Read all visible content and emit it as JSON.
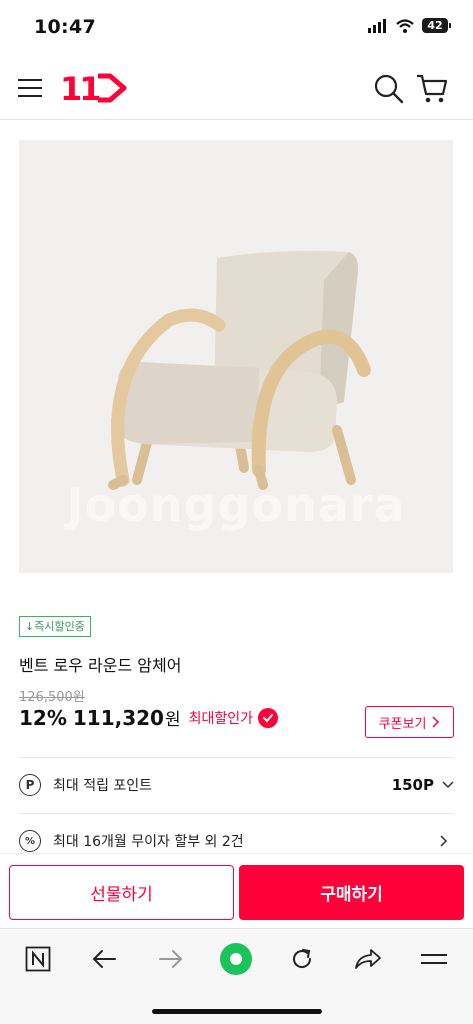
{
  "status_bar": {
    "time": "10:47",
    "battery": "42"
  },
  "header": {
    "logo_text": "11"
  },
  "product": {
    "image_watermark": "Joonggonara",
    "badge": "↓즉시할인중",
    "title": "벤트 로우 라운드 암체어",
    "original_price": "126,500원",
    "discount_rate": "12%",
    "sale_price": "111,320",
    "currency": "원",
    "max_discount_label": "최대할인가",
    "coupon_label": "쿠폰보기"
  },
  "info_rows": [
    {
      "icon": "P",
      "label": "최대 적립 포인트",
      "value": "150P"
    },
    {
      "icon": "%",
      "label": "최대 16개월 무이자 할부 외 2건",
      "value": ""
    }
  ],
  "actions": {
    "gift": "선물하기",
    "buy": "구매하기"
  },
  "colors": {
    "brand": "#ff0038",
    "badge_green": "#2e9c5a",
    "browser_green": "#19c45a"
  },
  "icons": [
    "hamburger-icon",
    "logo-icon",
    "search-icon",
    "cart-icon",
    "check-icon",
    "chevron-right-icon",
    "chevron-down-icon",
    "n-home-icon",
    "back-icon",
    "forward-icon",
    "green-dot-icon",
    "reload-icon",
    "share-icon",
    "menu-icon"
  ]
}
